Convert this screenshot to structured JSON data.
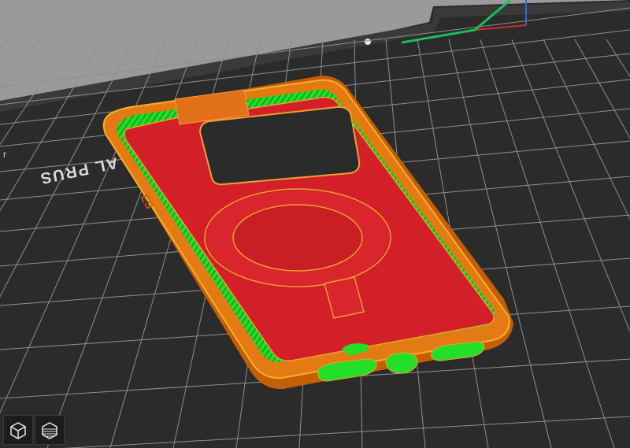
{
  "viewport": {
    "bed_label": "AL PRUS",
    "bed_label_partial": "r",
    "case_text": "ES"
  },
  "toolbar": {
    "view_3d_icon": "cube-icon",
    "layers_icon": "layers-icon"
  },
  "colors": {
    "background": "#9a9a9a",
    "bed": "#2b2b2b",
    "grid": "#8f8f8f",
    "shell": "#e47a13",
    "top_fill": "#d31f27",
    "wall_infill": "#22e02a",
    "axis_x": "#d42a2a",
    "axis_y": "#1bbf55",
    "axis_z": "#2c6be0"
  }
}
